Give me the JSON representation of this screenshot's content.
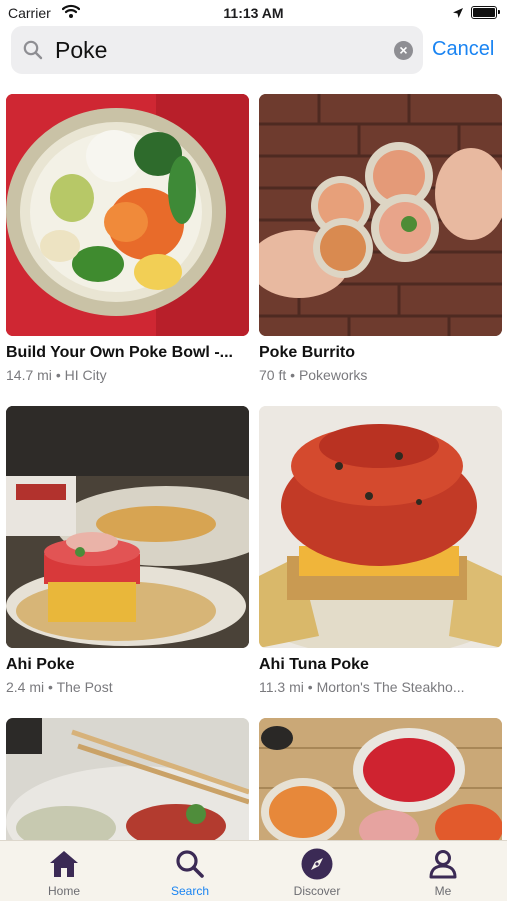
{
  "status_bar": {
    "carrier": "Carrier",
    "time": "11:13 AM"
  },
  "search": {
    "query": "Poke",
    "cancel_label": "Cancel"
  },
  "results": [
    {
      "title": "Build Your Own Poke Bowl -...",
      "distance": "14.7 mi",
      "place": "HI City"
    },
    {
      "title": "Poke Burrito",
      "distance": "70 ft",
      "place": "Pokeworks"
    },
    {
      "title": "Ahi Poke",
      "distance": "2.4 mi",
      "place": "The Post"
    },
    {
      "title": "Ahi Tuna Poke",
      "distance": "11.3 mi",
      "place": "Morton's The Steakho..."
    }
  ],
  "meta_separator": "•",
  "tabs": [
    {
      "label": "Home",
      "icon": "home-icon",
      "active": false
    },
    {
      "label": "Search",
      "icon": "search-icon",
      "active": true
    },
    {
      "label": "Discover",
      "icon": "compass-icon",
      "active": false
    },
    {
      "label": "Me",
      "icon": "person-icon",
      "active": false
    }
  ],
  "colors": {
    "accent": "#1a84f2",
    "tab_inactive": "#3b2a55",
    "tab_bar_bg": "#f6f3ec"
  }
}
